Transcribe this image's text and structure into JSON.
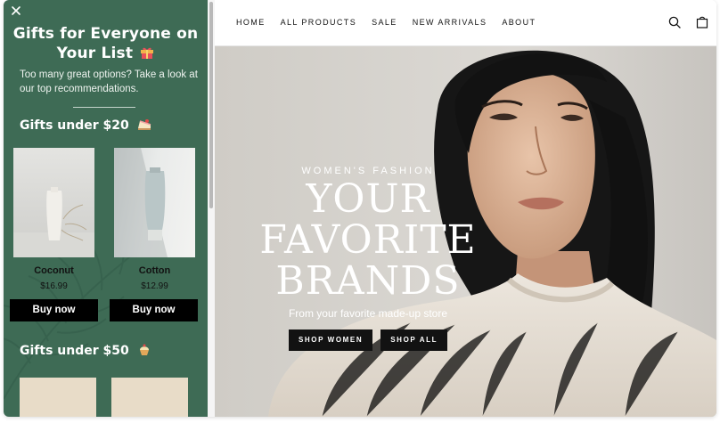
{
  "drawer": {
    "title_line1": "Gifts for Everyone on",
    "title_line2": "Your List",
    "title_icon": "gift-icon",
    "subtitle": "Too many great options? Take a look at our top recommendations.",
    "sections": [
      {
        "title": "Gifts under $20",
        "icon": "cake-slice-icon"
      },
      {
        "title": "Gifts under $50",
        "icon": "cupcake-icon"
      }
    ],
    "products": [
      {
        "name": "Coconut",
        "price": "$16.99",
        "button": "Buy now"
      },
      {
        "name": "Cotton",
        "price": "$12.99",
        "button": "Buy now"
      }
    ],
    "colors": {
      "background": "#3e6b55",
      "button": "#000000"
    }
  },
  "header": {
    "nav": [
      "HOME",
      "ALL PRODUCTS",
      "SALE",
      "NEW ARRIVALS",
      "ABOUT"
    ],
    "icons": [
      "search-icon",
      "shopping-bag-icon"
    ]
  },
  "hero": {
    "eyebrow": "WOMEN'S FASHION",
    "headline_line1": "YOUR FAVORITE",
    "headline_line2": "BRANDS",
    "tagline": "From your favorite made-up store",
    "buttons": [
      "SHOP WOMEN",
      "SHOP ALL"
    ]
  }
}
